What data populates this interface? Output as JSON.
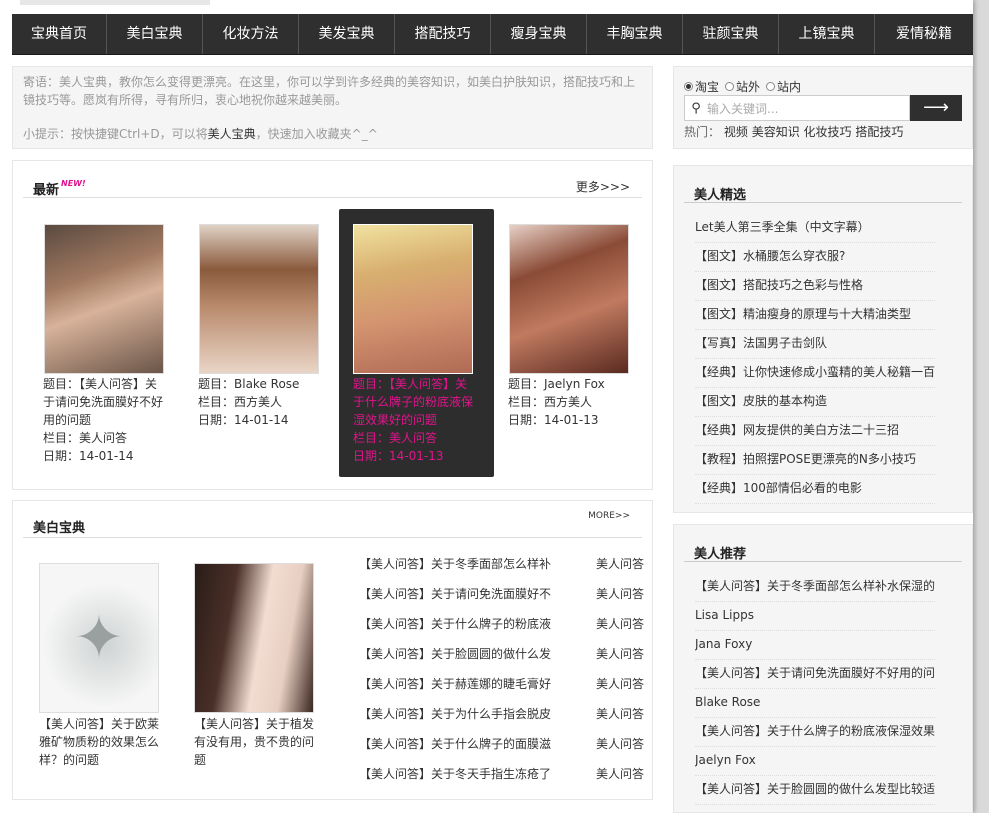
{
  "nav": {
    "items": [
      "宝典首页",
      "美白宝典",
      "化妆方法",
      "美发宝典",
      "搭配技巧",
      "瘦身宝典",
      "丰胸宝典",
      "驻颜宝典",
      "上镜宝典",
      "爱情秘籍"
    ]
  },
  "notice": {
    "text": "寄语：美人宝典，教你怎么变得更漂亮。在这里，你可以学到许多经典的美容知识，如美白护肤知识，搭配技巧和上镜技巧等。愿岚有所得，寻有所归，衷心地祝你越来越美丽。",
    "tip_prefix": "小提示：按快捷键Ctrl+D，可以将",
    "tip_highlight": "美人宝典",
    "tip_suffix": "，快速加入收藏夹^_^"
  },
  "search": {
    "options": [
      "淘宝",
      "站外",
      "站内"
    ],
    "selected": "淘宝",
    "placeholder": "输入关键词...",
    "button": "⟶",
    "hot_label": "热门：",
    "hot_links": [
      "视频",
      "美容知识",
      "化妆技巧",
      "搭配技巧"
    ]
  },
  "latest": {
    "title": "最新",
    "new_badge": "NEW!",
    "more": "更多>>>",
    "cards": [
      {
        "title": "题目：【美人问答】关于请问免洗面膜好不好用的问题",
        "column": "栏目：美人问答",
        "date": "日期：14-01-14"
      },
      {
        "title": "题目：Blake Rose",
        "column": "栏目：西方美人",
        "date": "日期：14-01-14"
      },
      {
        "title": "题目：【美人问答】关于什么牌子的粉底液保湿效果好的问题",
        "column": "栏目：美人问答",
        "date": "日期：14-01-13"
      },
      {
        "title": "题目：Jaelyn Fox",
        "column": "栏目：西方美人",
        "date": "日期：14-01-13"
      }
    ]
  },
  "whitening": {
    "title": "美白宝典",
    "more": "MORE>>",
    "cards": [
      {
        "title": "【美人问答】关于欧莱雅矿物质粉的效果怎么样？的问题"
      },
      {
        "title": "【美人问答】关于植发有没有用，贵不贵的问题"
      }
    ],
    "list": [
      {
        "title": "【美人问答】关于冬季面部怎么样补",
        "tag": "美人问答"
      },
      {
        "title": "【美人问答】关于请问免洗面膜好不",
        "tag": "美人问答"
      },
      {
        "title": "【美人问答】关于什么牌子的粉底液",
        "tag": "美人问答"
      },
      {
        "title": "【美人问答】关于脸圆圆的做什么发",
        "tag": "美人问答"
      },
      {
        "title": "【美人问答】关于赫莲娜的睫毛膏好",
        "tag": "美人问答"
      },
      {
        "title": "【美人问答】关于为什么手指会脱皮",
        "tag": "美人问答"
      },
      {
        "title": "【美人问答】关于什么牌子的面膜滋",
        "tag": "美人问答"
      },
      {
        "title": "【美人问答】关于冬天手指生冻疮了",
        "tag": "美人问答"
      }
    ]
  },
  "picks": {
    "title": "美人精选",
    "items": [
      "Let美人第三季全集（中文字幕）",
      "【图文】水桶腰怎么穿衣服?",
      "【图文】搭配技巧之色彩与性格",
      "【图文】精油瘦身的原理与十大精油类型",
      "【写真】法国男子击剑队",
      "【经典】让你快速修成小蛮精的美人秘籍一百",
      "【图文】皮肤的基本构造",
      "【经典】网友提供的美白方法二十三招",
      "【教程】拍照摆POSE更漂亮的N多小技巧",
      "【经典】100部情侣必看的电影"
    ]
  },
  "recommend": {
    "title": "美人推荐",
    "items": [
      "【美人问答】关于冬季面部怎么样补水保湿的",
      "Lisa Lipps",
      "Jana Foxy",
      "【美人问答】关于请问免洗面膜好不好用的问",
      "Blake Rose",
      "【美人问答】关于什么牌子的粉底液保湿效果",
      "Jaelyn Fox",
      "【美人问答】关于脸圆圆的做什么发型比较适"
    ]
  }
}
